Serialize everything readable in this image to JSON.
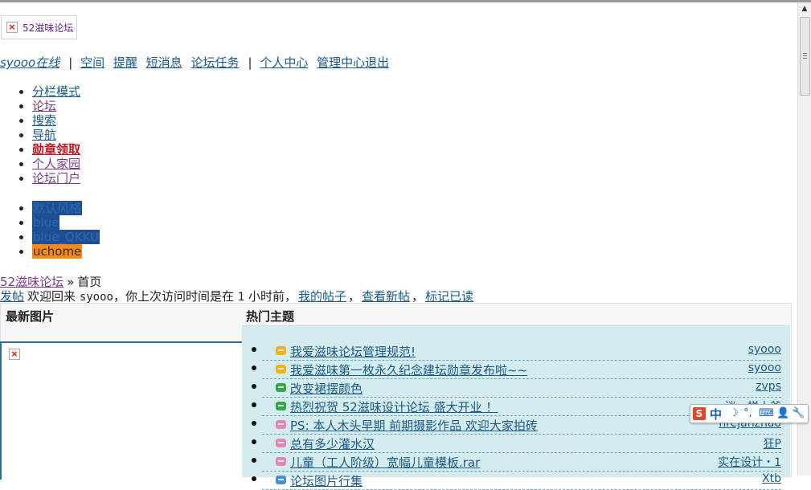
{
  "logo": {
    "alt": "52滋味论坛",
    "broken_icon": "broken-image-icon"
  },
  "userbar": {
    "username": "syooo在线",
    "sep": "|",
    "links": [
      "空间",
      "提醒",
      "短消息",
      "论坛任务"
    ],
    "links2": [
      "个人中心",
      "管理中心",
      "退出"
    ]
  },
  "nav": [
    "分栏模式",
    "论坛",
    "搜索",
    "导航",
    "勋章领取",
    "个人家园",
    "论坛门户"
  ],
  "styles": [
    "默认风格",
    "blue",
    "blue_QKKU",
    "uchome"
  ],
  "breadcrumb": {
    "home": "52滋味论坛",
    "arrow": "»",
    "current": "首页"
  },
  "welcome": {
    "post_link": "发帖",
    "text_a": "欢迎回来",
    "user": "syooo",
    "text_b": "，你上次访问时间是在",
    "num": "1",
    "text_c": "小时前，",
    "my_posts": "我的帖子",
    "comma": "，",
    "new_posts": "查看新帖",
    "comma2": "，",
    "mark_read": "标记已读"
  },
  "panel": {
    "latest_images": "最新图片",
    "hot_topics": "热门主题"
  },
  "hot_topics": [
    {
      "title": "我爱滋味论坛管理规范!",
      "author": "syooo",
      "icon_color": "#f3b21b"
    },
    {
      "title": "我爱滋味第一枚永久纪念建坛勋章发布啦~~",
      "author": "syooo",
      "icon_color": "#f3b21b"
    },
    {
      "title": "改变裙摆颜色",
      "author": "zvps",
      "icon_color": "#37a84a"
    },
    {
      "title": "热烈祝贺 52滋味设计论坛 盛大开业 ！",
      "author": "迷一样大爷",
      "icon_color": "#37a84a"
    },
    {
      "title": "PS: 本人木头早期 前期摄影作品 欢迎大家拍砖",
      "author": "hrejanzhao",
      "icon_color": "#e487b2"
    },
    {
      "title": "总有多少灌水汉",
      "author": "狂P",
      "icon_color": "#e487b2"
    },
    {
      "title": "儿童（工人阶级）宽幅儿童模板.rar",
      "author": "实在设计・1",
      "icon_color": "#e487b2"
    },
    {
      "title": "论坛图片行集",
      "author": "Xtb",
      "icon_color": "#4a90d9"
    }
  ],
  "ime": {
    "logo": "S",
    "zh": "中",
    "icons": [
      "moon-icon",
      "punctuation-icon",
      "keyboard-icon",
      "user-icon",
      "wrench-icon"
    ]
  }
}
